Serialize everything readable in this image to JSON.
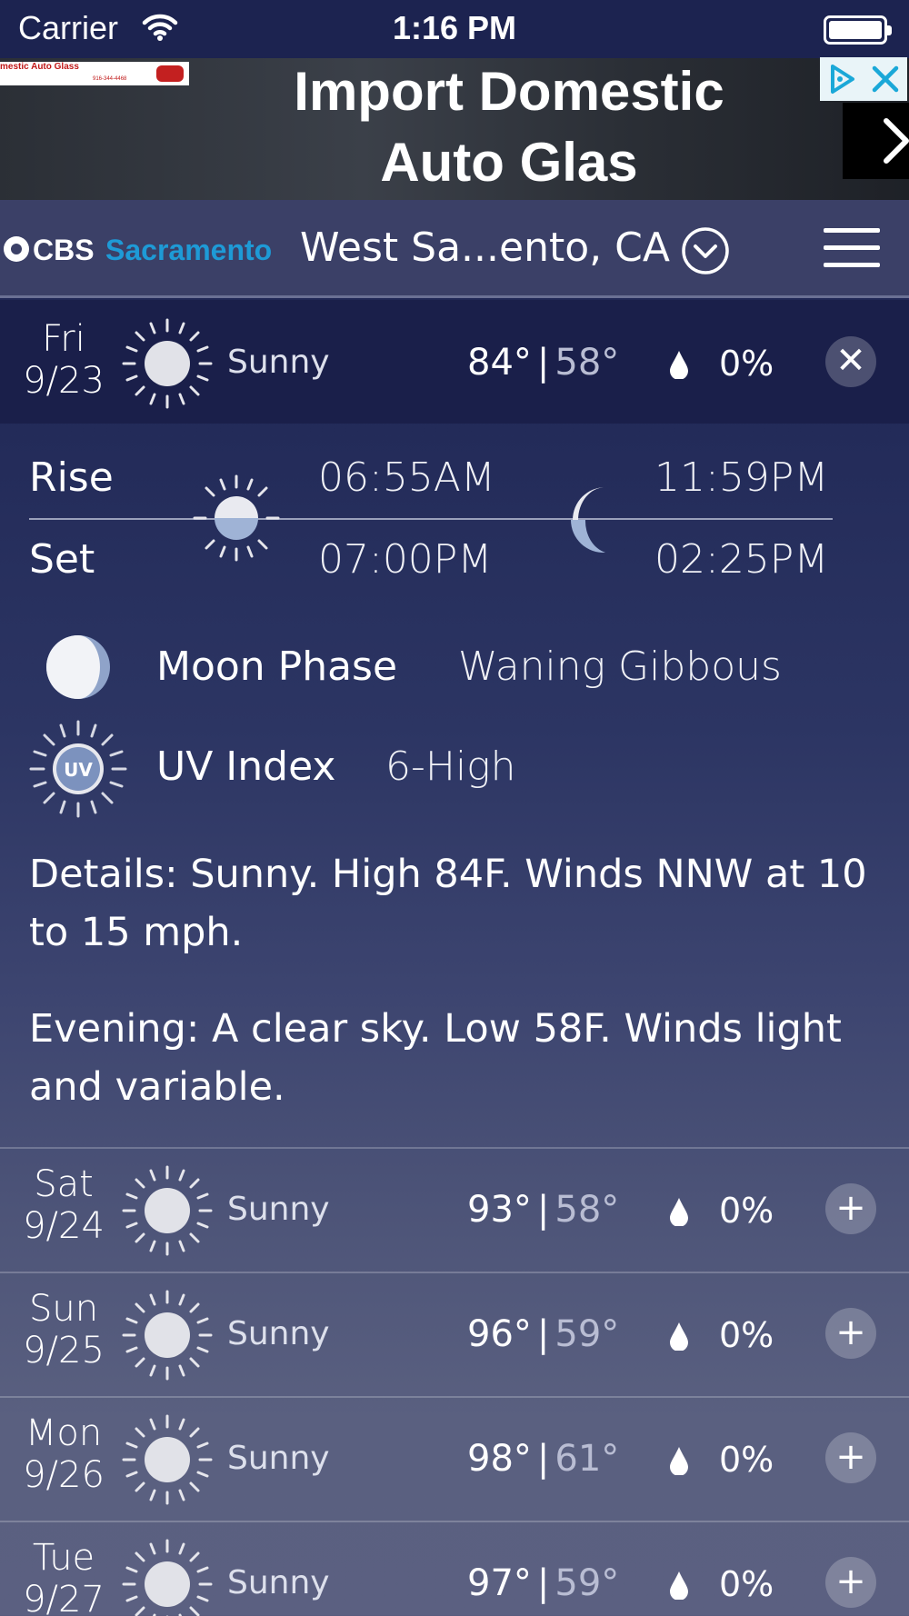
{
  "status_bar": {
    "carrier": "Carrier",
    "time": "1:16 PM"
  },
  "ad": {
    "headline_line1": "Import Domestic",
    "headline_line2": "Auto Glas",
    "logo_name": "mestic Auto Glass",
    "logo_phone": "916-344-4468"
  },
  "header": {
    "logo_cbs": "CBS",
    "logo_city": "Sacramento",
    "location": "West Sa...ento, CA"
  },
  "today": {
    "day": "Fri",
    "date": "9/23",
    "condition": "Sunny",
    "high": "84°",
    "low": "58°",
    "precip": "0%",
    "rise_label": "Rise",
    "set_label": "Set",
    "sunrise": "06:55AM",
    "sunset": "07:00PM",
    "moonrise": "11:59PM",
    "moonset": "02:25PM",
    "moon_phase_label": "Moon Phase",
    "moon_phase": "Waning Gibbous",
    "uv_icon_text": "UV",
    "uv_label": "UV Index",
    "uv_value": "6-High",
    "details": "Details: Sunny. High 84F. Winds NNW at 10 to 15 mph.",
    "evening": "Evening: A clear sky. Low 58F. Winds light and variable."
  },
  "forecast": [
    {
      "day": "Sat",
      "date": "9/24",
      "condition": "Sunny",
      "high": "93°",
      "low": "58°",
      "precip": "0%"
    },
    {
      "day": "Sun",
      "date": "9/25",
      "condition": "Sunny",
      "high": "96°",
      "low": "59°",
      "precip": "0%"
    },
    {
      "day": "Mon",
      "date": "9/26",
      "condition": "Sunny",
      "high": "98°",
      "low": "61°",
      "precip": "0%"
    },
    {
      "day": "Tue",
      "date": "9/27",
      "condition": "Sunny",
      "high": "97°",
      "low": "59°",
      "precip": "0%"
    }
  ],
  "icons": {
    "wifi": "wifi-icon",
    "battery": "battery-icon",
    "dropdown": "chevron-down-circle-icon",
    "menu": "hamburger-menu-icon",
    "sun": "sun-icon",
    "moon": "crescent-moon-icon",
    "moon_phase": "moon-phase-icon",
    "uv": "uv-index-icon",
    "precip": "raindrop-icon",
    "close": "close-icon",
    "expand": "plus-icon"
  },
  "colors": {
    "accent_blue": "#1e9ad6",
    "header_bg": "#3b4067",
    "today_row_bg": "#1a1f4a"
  }
}
